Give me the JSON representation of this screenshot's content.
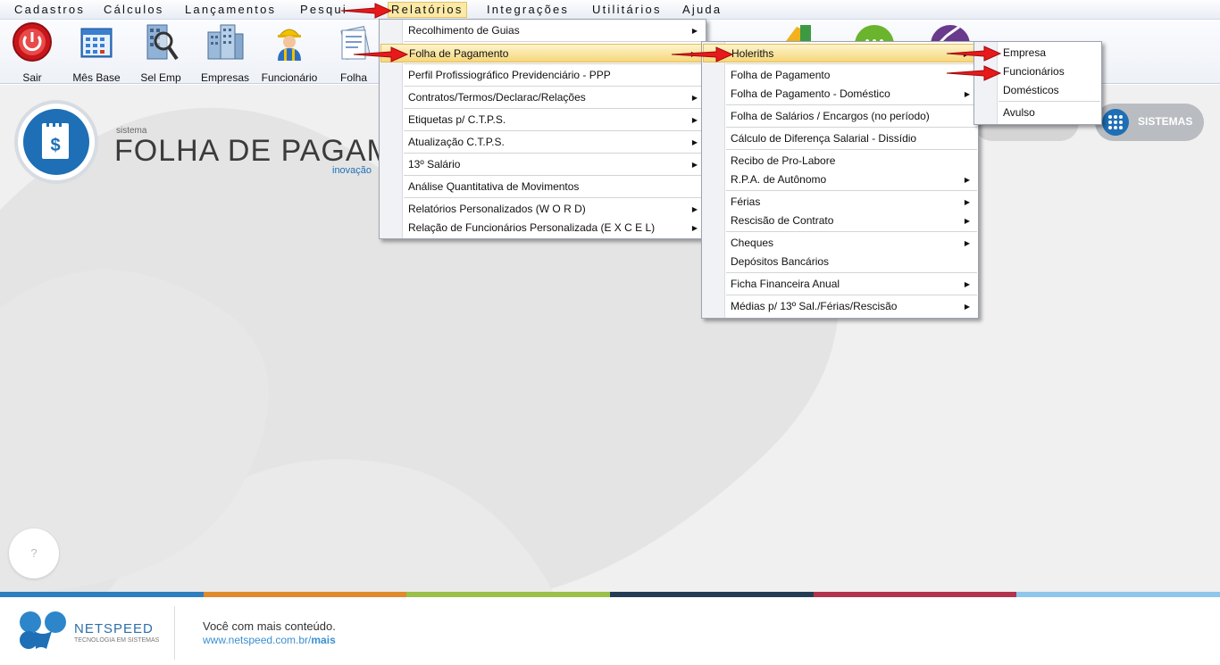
{
  "menubar": {
    "items": [
      "Cadastros",
      "Cálculos",
      "Lançamentos",
      "Pesquisa",
      "Relatórios",
      "Integrações",
      "Utilitários",
      "Ajuda"
    ],
    "pesquisa_visible": "Pesqui"
  },
  "toolbar": {
    "buttons": [
      {
        "label": "Sair",
        "icon": "power-icon"
      },
      {
        "label": "Mês Base",
        "icon": "calendar-icon"
      },
      {
        "label": "Sel Emp",
        "icon": "search-building-icon"
      },
      {
        "label": "Empresas",
        "icon": "buildings-icon"
      },
      {
        "label": "Funcionário",
        "icon": "worker-icon"
      },
      {
        "label": "Folha",
        "icon": "document-icon"
      }
    ]
  },
  "brand": {
    "small": "sistema",
    "title": "FOLHA DE PAGAMEN",
    "tagline": "inovação"
  },
  "sistemas_button": "SISTEMAS",
  "help_button": "?",
  "menu_relatorios": {
    "items": [
      {
        "label": "Recolhimento de Guias",
        "submenu": true
      },
      {
        "label": "Folha de Pagamento",
        "submenu": true,
        "highlighted": true
      },
      {
        "label": "Perfil Profissiográfico Previdenciário - PPP",
        "submenu": false
      },
      {
        "label": "Contratos/Termos/Declarac/Relações",
        "submenu": true
      },
      {
        "label": "Etiquetas p/ C.T.P.S.",
        "submenu": true
      },
      {
        "label": "Atualização C.T.P.S.",
        "submenu": true
      },
      {
        "label": "13º Salário",
        "submenu": true
      },
      {
        "label": "Análise Quantitativa de Movimentos",
        "submenu": false
      },
      {
        "label": "Relatórios Personalizados (W O R D)",
        "submenu": true
      },
      {
        "label": "Relação de Funcionários Personalizada (E X C E L)",
        "submenu": true
      }
    ]
  },
  "menu_folha": {
    "items": [
      {
        "label": "Holeriths",
        "submenu": true,
        "highlighted": true
      },
      {
        "label": "Folha de Pagamento",
        "submenu": false
      },
      {
        "label": "Folha de Pagamento - Doméstico",
        "submenu": true
      },
      {
        "label": "Folha de Salários / Encargos (no período)",
        "submenu": false
      },
      {
        "label": "Cálculo de Diferença Salarial - Dissídio",
        "submenu": false
      },
      {
        "label": "Recibo de Pro-Labore",
        "submenu": false
      },
      {
        "label": "R.P.A. de Autônomo",
        "submenu": true
      },
      {
        "label": "Férias",
        "submenu": true
      },
      {
        "label": "Rescisão de Contrato",
        "submenu": true
      },
      {
        "label": "Cheques",
        "submenu": true
      },
      {
        "label": "Depósitos Bancários",
        "submenu": false
      },
      {
        "label": "Ficha Financeira Anual",
        "submenu": true
      },
      {
        "label": "Médias p/ 13º Sal./Férias/Rescisão",
        "submenu": true
      }
    ]
  },
  "menu_holeriths": {
    "items": [
      {
        "label": "Empresa"
      },
      {
        "label": "Funcionários"
      },
      {
        "label": "Domésticos"
      },
      {
        "label": "Avulso"
      }
    ]
  },
  "footer": {
    "brand": "NETSPEED",
    "brand_sub": "TECNOLOGIA EM SISTEMAS",
    "text": "Você com mais conteúdo.",
    "link_plain": "www.netspeed.com.br/",
    "link_bold": "mais"
  },
  "colors": {
    "stripe": [
      "#2d7fc0",
      "#e08a2c",
      "#9bc04a",
      "#243d55",
      "#b2334d",
      "#8fc6ec"
    ],
    "arrow": "#e8191b",
    "brand_blue": "#1e6fb5"
  }
}
